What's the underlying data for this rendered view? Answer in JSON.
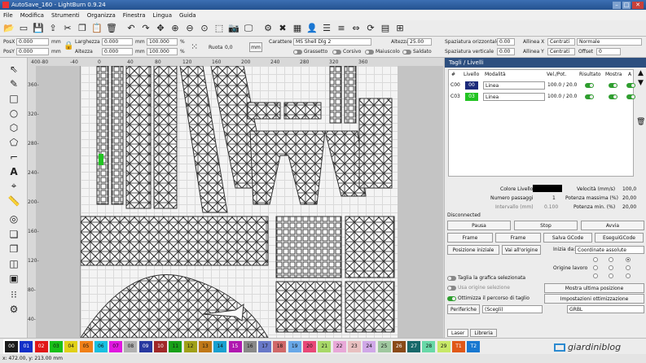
{
  "window": {
    "title": "AutoSave_160 - LightBurn 0.9.24",
    "buttons": [
      "–",
      "□",
      "✕"
    ]
  },
  "menu": [
    "File",
    "Modifica",
    "Strumenti",
    "Organizza",
    "Finestra",
    "Lingua",
    "Guida"
  ],
  "toolbar_icons": [
    "open-icon",
    "folder-icon",
    "save-icon",
    "import-icon",
    "cut-icon",
    "copy-icon",
    "paste-icon",
    "delete-icon",
    "undo-icon",
    "redo-icon",
    "move-icon",
    "zoom-in-icon",
    "zoom-out-icon",
    "zoom-fit-icon",
    "frame-icon",
    "camera-icon",
    "monitor-icon",
    "settings-icon",
    "tools-icon",
    "group-icon",
    "users-icon",
    "align-icon",
    "distribute-icon",
    "mirror-icon",
    "rotate-icon",
    "dock-icon",
    "center-icon"
  ],
  "props": {
    "posx_label": "PosX",
    "posx": "0.000",
    "posy_label": "PosY",
    "posy": "0.000",
    "unit_mm": "mm",
    "width_label": "Larghezza",
    "width": "0.000",
    "height_label": "Altezza",
    "height": "0.000",
    "scale_w": "100.000",
    "scale_h": "100.000",
    "pct": "%",
    "rotate_label": "Ruota",
    "rotate": "0,0",
    "mm_btn": "mm",
    "font_label": "Carattere",
    "font": "MS Shell Dlg 2",
    "text_height_label": "Altezza",
    "text_height": "25.00",
    "bold": "Grassetto",
    "italic": "Corsivo",
    "upper": "Maiuscolo",
    "welded": "Saldato",
    "hspace_label": "Spaziatura orizzontale",
    "hspace": "0.00",
    "vspace_label": "Spaziatura verticale",
    "vspace": "0.00",
    "alignx_label": "Allinea X",
    "alignx": "Centrati",
    "aligny_label": "Allinea Y",
    "aligny": "Centrati",
    "normal": "Normale",
    "offset_label": "Offset",
    "offset": "0"
  },
  "left_tools": [
    "select-icon",
    "pen-icon",
    "rectangle-icon",
    "ellipse-icon",
    "polygon-icon",
    "text-icon",
    "position-icon",
    "measure-icon",
    "offset-icon",
    "weld-icon",
    "boolean-icon",
    "array-icon",
    "grid-icon",
    "gear-icon"
  ],
  "ruler": {
    "top": [
      "400-80",
      "-40",
      "0",
      "40",
      "80",
      "120",
      "160",
      "200",
      "240",
      "280",
      "320",
      "360"
    ],
    "left": [
      "400-",
      "360-",
      "320-",
      "280-",
      "240-",
      "200-",
      "160-",
      "120-",
      "80-",
      "40-"
    ]
  },
  "panel": {
    "title": "Tagli / Livelli",
    "columns": [
      "#",
      "Livello",
      "Modalità",
      "Vel./Pot.",
      "Risultato",
      "Mostra",
      "A"
    ],
    "rows": [
      {
        "id": "C00",
        "layer": "00",
        "color": "#1b2a7a",
        "mode": "Linea",
        "speed": "100.0 / 20.0"
      },
      {
        "id": "C03",
        "layer": "03",
        "color": "#22c322",
        "mode": "Linea",
        "speed": "100.0 / 20.0"
      }
    ],
    "layer_color_label": "Colore Livello",
    "passes_label": "Numero passaggi",
    "passes": "1",
    "interval_label": "Intervallo (mm)",
    "interval": "0.100",
    "speed_label": "Velocità (mm/s)",
    "speed": "100,0",
    "maxpow_label": "Potenza massima (%)",
    "maxpow": "20,00",
    "minpow_label": "Potenza min. (%)",
    "minpow": "20,00",
    "status": "Disconnected",
    "pause": "Pausa",
    "stop": "Stop",
    "start": "Avvia",
    "frame1": "Frame",
    "frame2": "Frame",
    "save_gcode": "Salva GCode",
    "run_gcode": "EseguiGCode",
    "home": "Posizione iniziale",
    "goto_origin": "Vai all'origine",
    "start_from_label": "Inizia da:",
    "start_from": "Coordinate assolute",
    "origin_label": "Origine lavoro",
    "cut_selected": "Taglia la grafica selezionata",
    "use_origin": "Usa origine selezione",
    "optimize": "Ottimizza il percorso di taglio",
    "show_last": "Mostra ultima posizione",
    "opt_settings": "Impostazioni ottimizzazione",
    "devices": "Periferiche",
    "choose": "(Scegli)",
    "grbl": "GRBL",
    "tab_laser": "Laser",
    "tab_library": "Libreria"
  },
  "palette": [
    {
      "n": "00",
      "c": "#1a1a1a",
      "t": "#fff"
    },
    {
      "n": "01",
      "c": "#1230c8",
      "t": "#fff"
    },
    {
      "n": "02",
      "c": "#e01818",
      "t": "#fff"
    },
    {
      "n": "03",
      "c": "#18c018",
      "t": "#111"
    },
    {
      "n": "04",
      "c": "#e0d018",
      "t": "#111"
    },
    {
      "n": "05",
      "c": "#f08018",
      "t": "#111"
    },
    {
      "n": "06",
      "c": "#18c0e0",
      "t": "#111"
    },
    {
      "n": "07",
      "c": "#e018e0",
      "t": "#111"
    },
    {
      "n": "08",
      "c": "#b0b0b0",
      "t": "#111"
    },
    {
      "n": "09",
      "c": "#2838a0",
      "t": "#fff"
    },
    {
      "n": "10",
      "c": "#a02828",
      "t": "#fff"
    },
    {
      "n": "11",
      "c": "#18a018",
      "t": "#111"
    },
    {
      "n": "12",
      "c": "#a0a018",
      "t": "#111"
    },
    {
      "n": "13",
      "c": "#c07818",
      "t": "#111"
    },
    {
      "n": "14",
      "c": "#18a0d0",
      "t": "#111"
    },
    {
      "n": "15",
      "c": "#b018b0",
      "t": "#fff"
    },
    {
      "n": "16",
      "c": "#888888",
      "t": "#111"
    },
    {
      "n": "17",
      "c": "#6878c8",
      "t": "#111"
    },
    {
      "n": "18",
      "c": "#d06868",
      "t": "#111"
    },
    {
      "n": "19",
      "c": "#68a8e8",
      "t": "#111"
    },
    {
      "n": "20",
      "c": "#e84878",
      "t": "#111"
    },
    {
      "n": "21",
      "c": "#a8d868",
      "t": "#111"
    },
    {
      "n": "22",
      "c": "#e8a8d8",
      "t": "#111"
    },
    {
      "n": "23",
      "c": "#e8c0c0",
      "t": "#111"
    },
    {
      "n": "24",
      "c": "#d0a8e8",
      "t": "#111"
    },
    {
      "n": "25",
      "c": "#a0c8a0",
      "t": "#111"
    },
    {
      "n": "26",
      "c": "#8a4a18",
      "t": "#fff"
    },
    {
      "n": "27",
      "c": "#18686a",
      "t": "#fff"
    },
    {
      "n": "28",
      "c": "#68d8a8",
      "t": "#111"
    },
    {
      "n": "29",
      "c": "#c8e868",
      "t": "#111"
    },
    {
      "n": "T1",
      "c": "#e05818",
      "t": "#fff"
    },
    {
      "n": "T2",
      "c": "#1878d0",
      "t": "#fff"
    }
  ],
  "statusbar": "x: 472.00, y: 213.00 mm",
  "logo": "giardiniblog"
}
